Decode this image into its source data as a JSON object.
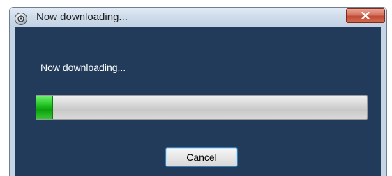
{
  "window": {
    "title": "Now downloading...",
    "app_icon": "app-logo-icon",
    "close_icon": "close-icon"
  },
  "dialog": {
    "message": "Now downloading...",
    "progress_fraction": 0.05,
    "cancel_label": "Cancel"
  },
  "colors": {
    "content_background": "#223b5a",
    "progress_fill": "#22c322",
    "close_button": "#c14a33"
  }
}
